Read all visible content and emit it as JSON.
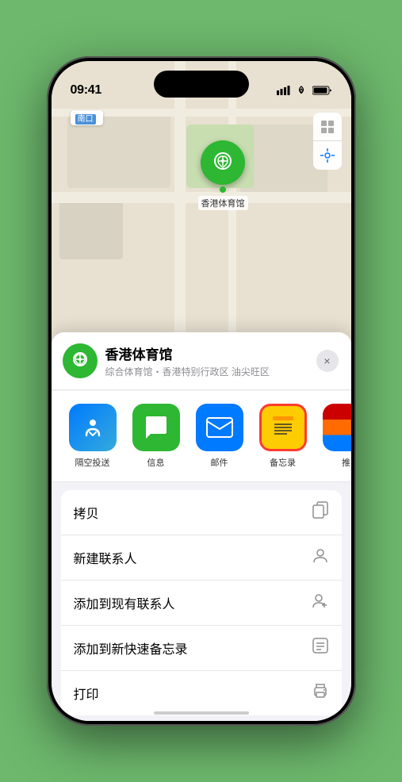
{
  "status": {
    "time": "09:41",
    "signal_icon": "▪▪▪▪",
    "wifi_icon": "wifi",
    "battery_icon": "battery"
  },
  "map": {
    "location_label": "南口",
    "pin_name": "香港体育馆"
  },
  "map_controls": {
    "map_type_icon": "map",
    "location_icon": "arrow"
  },
  "sheet": {
    "venue_name": "香港体育馆",
    "venue_sub": "综合体育馆・香港特别行政区 油尖旺区",
    "close_label": "×"
  },
  "share_items": [
    {
      "label": "隔空投送",
      "type": "airdrop"
    },
    {
      "label": "信息",
      "type": "messages"
    },
    {
      "label": "邮件",
      "type": "mail"
    },
    {
      "label": "备忘录",
      "type": "notes"
    },
    {
      "label": "推",
      "type": "more"
    }
  ],
  "actions": [
    {
      "label": "拷贝",
      "icon": "📋"
    },
    {
      "label": "新建联系人",
      "icon": "👤"
    },
    {
      "label": "添加到现有联系人",
      "icon": "👤"
    },
    {
      "label": "添加到新快速备忘录",
      "icon": "📝"
    },
    {
      "label": "打印",
      "icon": "🖨"
    }
  ]
}
